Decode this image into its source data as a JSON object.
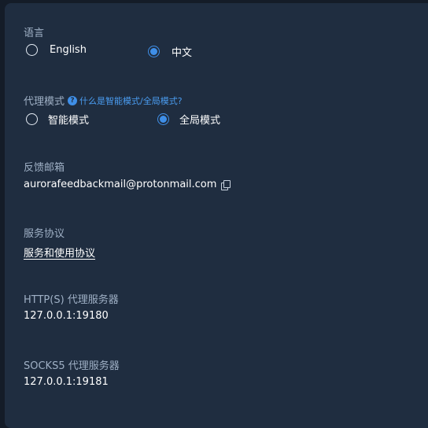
{
  "language": {
    "label": "语言",
    "options": [
      {
        "label": "English",
        "selected": false
      },
      {
        "label": "中文",
        "selected": true
      }
    ]
  },
  "proxy_mode": {
    "label": "代理模式",
    "help_icon": "question-icon",
    "help_text": "什么是智能模式/全局模式?",
    "options": [
      {
        "label": "智能模式",
        "selected": false
      },
      {
        "label": "全局模式",
        "selected": true
      }
    ]
  },
  "feedback": {
    "label": "反馈邮箱",
    "email": "aurorafeedbackmail@protonmail.com",
    "copy_icon": "copy-icon"
  },
  "terms": {
    "label": "服务协议",
    "link": "服务和使用协议"
  },
  "http_proxy": {
    "label": "HTTP(S) 代理服务器",
    "address": "127.0.0.1:19180"
  },
  "socks_proxy": {
    "label": "SOCKS5 代理服务器",
    "address": "127.0.0.1:19181"
  },
  "colors": {
    "panel_bg": "#1f2d40",
    "outer_bg": "#141c28",
    "accent": "#3f8fe8",
    "label": "#9fb0c5",
    "text": "#ffffff"
  }
}
